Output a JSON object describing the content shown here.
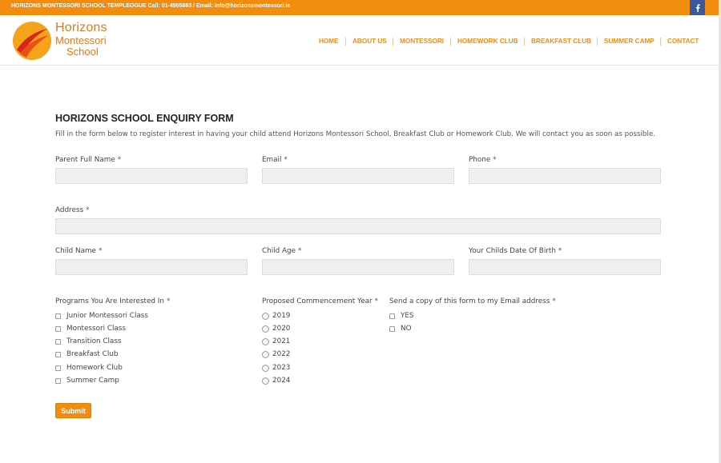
{
  "topbar": {
    "text": "HORIZONS MONTESSORI SCHOOL TEMPLEOGUE Call: 01-4905883 / Email: info@horizonsmontessori.ie",
    "social_icon": "facebook-icon"
  },
  "logo": {
    "line1": "Horizons",
    "line2": "Montessori",
    "line3": "School"
  },
  "nav": [
    "HOME",
    "ABOUT US",
    "MONTESSORI",
    "HOMEWORK CLUB",
    "BREAKFAST CLUB",
    "SUMMER CAMP",
    "CONTACT"
  ],
  "form": {
    "title": "HORIZONS SCHOOL ENQUIRY FORM",
    "description": "Fill in the form below to register interest in having your child attend Horizons Montessori School, Breakfast Club or Homework Club. We will contact you as soon as possible.",
    "required_mark": "*",
    "fields": {
      "parent_name": {
        "label": "Parent Full Name",
        "value": ""
      },
      "email": {
        "label": "Email",
        "value": ""
      },
      "phone": {
        "label": "Phone",
        "value": ""
      },
      "address": {
        "label": "Address",
        "value": ""
      },
      "child_name": {
        "label": "Child Name",
        "value": ""
      },
      "child_age": {
        "label": "Child Age",
        "value": ""
      },
      "child_dob": {
        "label": "Your Childs Date Of Birth",
        "value": ""
      }
    },
    "programs": {
      "label": "Programs You Are Interested In",
      "options": [
        "Junior Montessori Class",
        "Montessori Class",
        "Transition Class",
        "Breakfast Club",
        "Homework Club",
        "Summer Camp"
      ]
    },
    "years": {
      "label": "Proposed Commencement Year",
      "options": [
        "2019",
        "2020",
        "2021",
        "2022",
        "2023",
        "2024"
      ]
    },
    "copy": {
      "label": "Send a copy of this form to my Email address",
      "options": [
        "YES",
        "NO"
      ]
    },
    "submit_label": "Submit"
  },
  "colors": {
    "accent": "#f28c0f",
    "facebook": "#3b5998",
    "field_bg": "#efefef"
  }
}
